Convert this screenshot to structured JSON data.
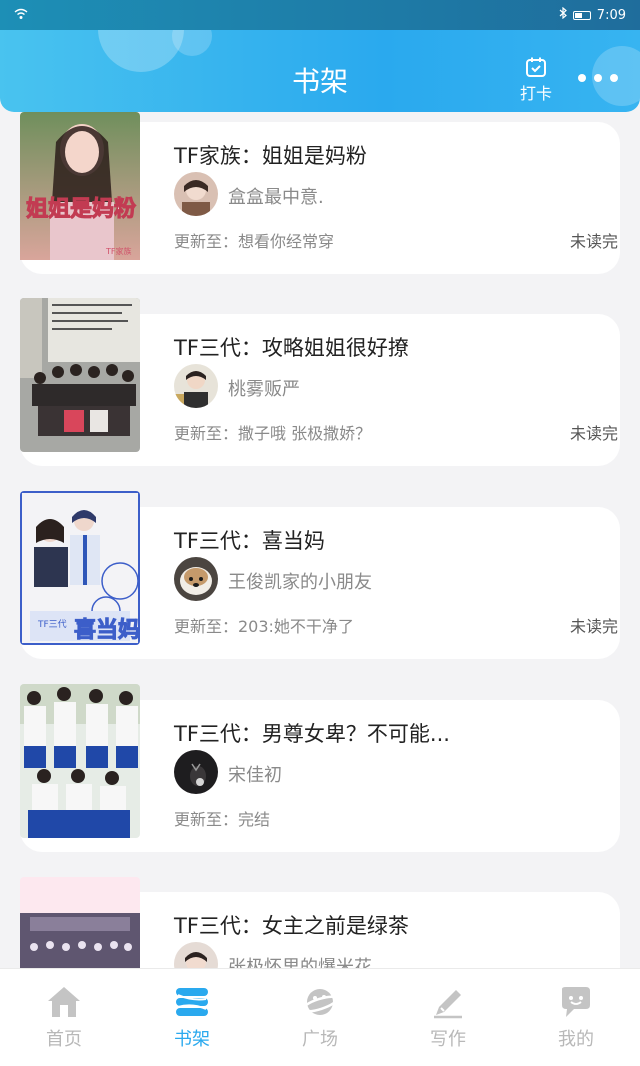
{
  "status_bar": {
    "time": "7:09"
  },
  "header": {
    "title": "书架",
    "checkin_label": "打卡"
  },
  "books": [
    {
      "title": "TF家族：姐姐是妈粉",
      "author": "盒盒最中意.",
      "update": "更新至：想看你经常穿",
      "status": "未读完",
      "cover_text": "姐姐是妈粉",
      "cover_sub": "TF家族"
    },
    {
      "title": "TF三代：攻略姐姐很好撩",
      "author": "桃雾贩严",
      "update": "更新至：撒子哦 张极撒娇？",
      "status": "未读完"
    },
    {
      "title": "TF三代：喜当妈",
      "author": "王俊凯家的小朋友",
      "update": "更新至：203:她不干净了",
      "status": "未读完",
      "cover_text": "喜当妈",
      "cover_sub": "TF三代"
    },
    {
      "title": "TF三代：男尊女卑？不可能...",
      "author": "宋佳初",
      "update": "更新至：完结",
      "status": ""
    },
    {
      "title": "TF三代：女主之前是绿茶",
      "author": "张极怀里的爆米花",
      "update": "",
      "status": ""
    }
  ],
  "nav": [
    {
      "label": "首页",
      "icon": "home-icon",
      "active": false
    },
    {
      "label": "书架",
      "icon": "bookshelf-icon",
      "active": true
    },
    {
      "label": "广场",
      "icon": "planet-icon",
      "active": false
    },
    {
      "label": "写作",
      "icon": "pen-icon",
      "active": false
    },
    {
      "label": "我的",
      "icon": "chat-bubble-icon",
      "active": false
    }
  ],
  "colors": {
    "accent": "#2aa9ee",
    "header_start": "#49c3ef",
    "inactive": "#b8b8b8"
  }
}
